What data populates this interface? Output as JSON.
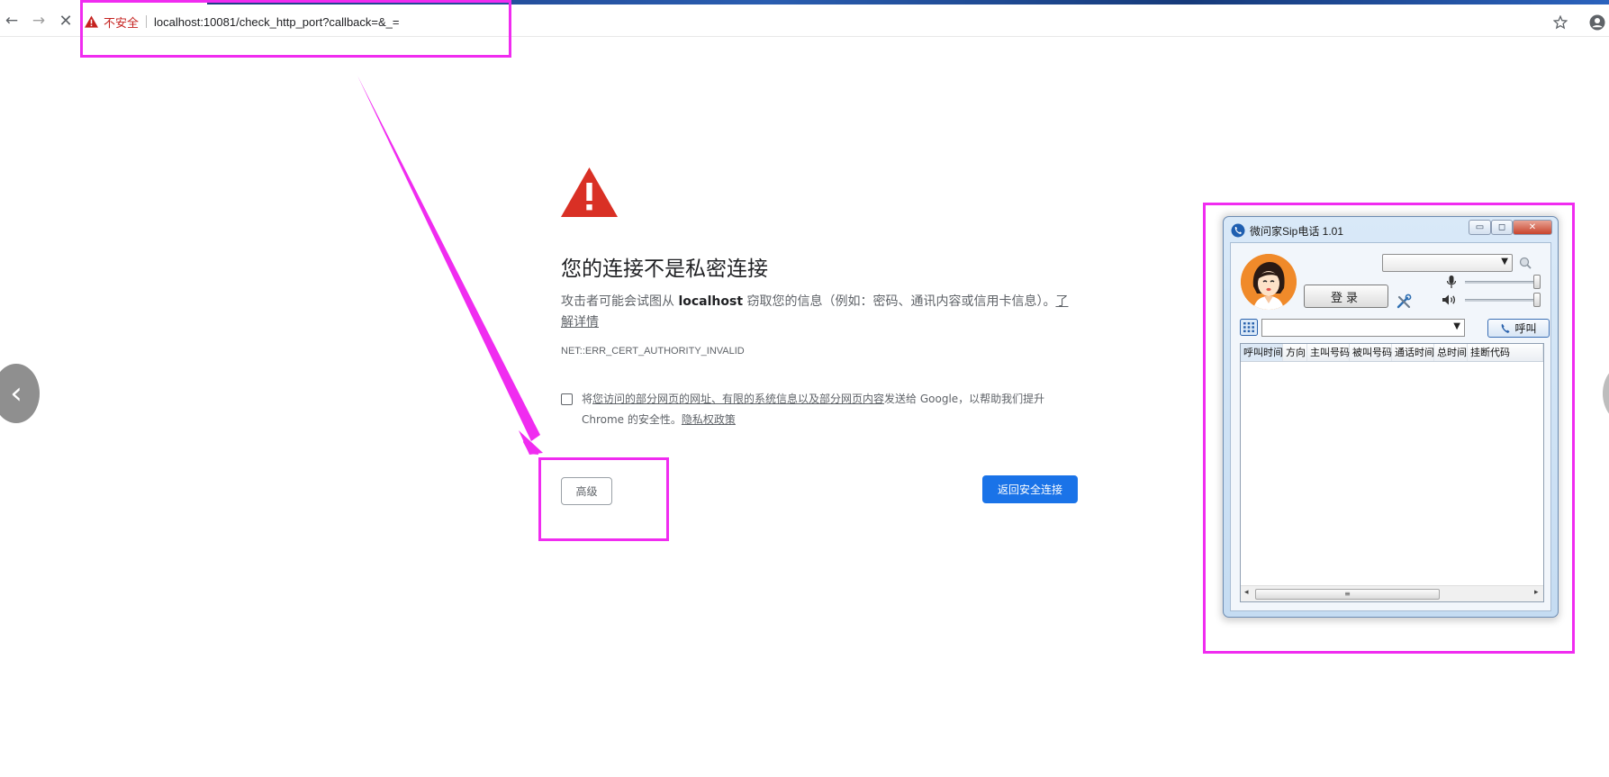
{
  "browser": {
    "not_secure_label": "不安全",
    "url": "localhost:10081/check_http_port?callback=&_=",
    "back_glyph": "←",
    "forward_glyph": "→",
    "stop_glyph": "✕"
  },
  "interstitial": {
    "title": "您的连接不是私密连接",
    "desc_prefix": "攻击者可能会试图从 ",
    "desc_host": "localhost",
    "desc_suffix": " 窃取您的信息（例如：密码、通讯内容或信用卡信息）。",
    "learn_more": "了解详情",
    "error_code": "NET::ERR_CERT_AUTHORITY_INVALID",
    "report_prefix": "将",
    "report_link": "您访问的部分网页的网址、有限的系统信息以及部分网页内容",
    "report_middle": "发送给 Google，以帮助我们提升 Chrome 的安全性。",
    "privacy_link": "隐私权政策",
    "advanced_label": "高级",
    "back_to_safety_label": "返回安全连接"
  },
  "carousel": {
    "prev_glyph": "‹"
  },
  "sip_window": {
    "title": "微问家Sip电话 1.01",
    "minimize_glyph": "▭",
    "maximize_glyph": "◻",
    "close_glyph": "✕",
    "login_label": "登录",
    "call_label": "呼叫",
    "dropdown_glyph": "▼",
    "columns": [
      "呼叫时间",
      "方向",
      "主叫号码",
      "被叫号码",
      "通话时间",
      "总时间",
      "挂断代码"
    ],
    "scroll_left_glyph": "◂",
    "scroll_right_glyph": "▸",
    "scroll_grip": "≡"
  },
  "colors": {
    "annotation": "#f02cf0",
    "primary_button": "#1a73e8",
    "warning_red": "#d93025"
  }
}
